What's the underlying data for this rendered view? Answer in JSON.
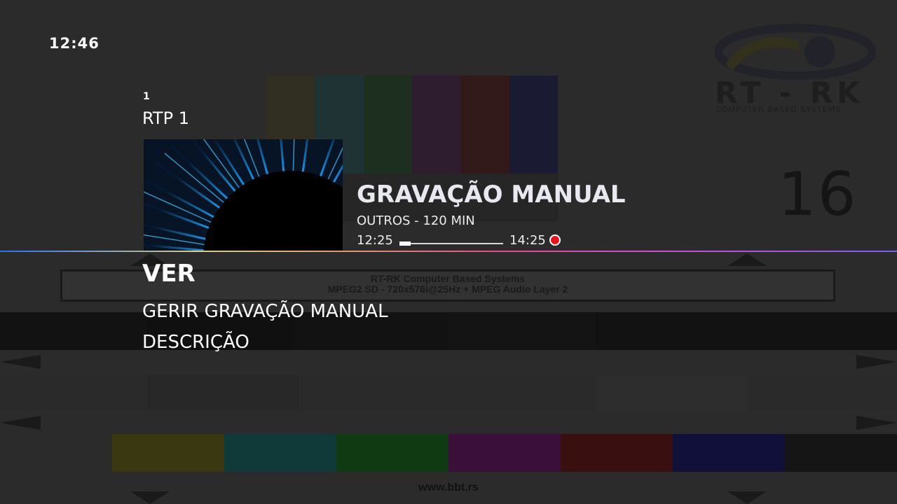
{
  "clock": "12:46",
  "channel": {
    "number": "1",
    "name": "RTP 1"
  },
  "program": {
    "title": "GRAVAÇÃO MANUAL",
    "genre_duration": "OUTROS - 120 MIN",
    "start_time": "12:25",
    "end_time": "14:25",
    "progress_fraction": 0.11,
    "recording": true
  },
  "menu": {
    "items": [
      {
        "label": "VER",
        "selected": true
      },
      {
        "label": "GERIR GRAVAÇÃO MANUAL",
        "selected": false
      },
      {
        "label": "DESCRIÇÃO",
        "selected": false
      }
    ]
  },
  "background_card": {
    "logo_text": "RT - RK",
    "logo_subtext": "COMPUTER BASED SYSTEMS",
    "number": "16",
    "info_line1": "RT-RK Computer Based Systems",
    "info_line2": "MPEG2 SD - 720x576i@25Hz + MPEG Audio Layer 2",
    "url": "www.bbt.rs"
  },
  "colors": {
    "accent_record": "#e8121e",
    "text_primary": "#ffffff",
    "top_bars": [
      "#302f22",
      "#1f3234",
      "#1d2f1f",
      "#2e1d2e",
      "#321a1a",
      "#1a1a33"
    ],
    "bottom_bars": [
      "#3a3810",
      "#103a3a",
      "#103a12",
      "#3a103a",
      "#3a0f0f",
      "#10103a",
      "#151515"
    ]
  },
  "icons": {
    "record": "record-dot-icon",
    "thumbnail": "program-thumbnail-image"
  }
}
